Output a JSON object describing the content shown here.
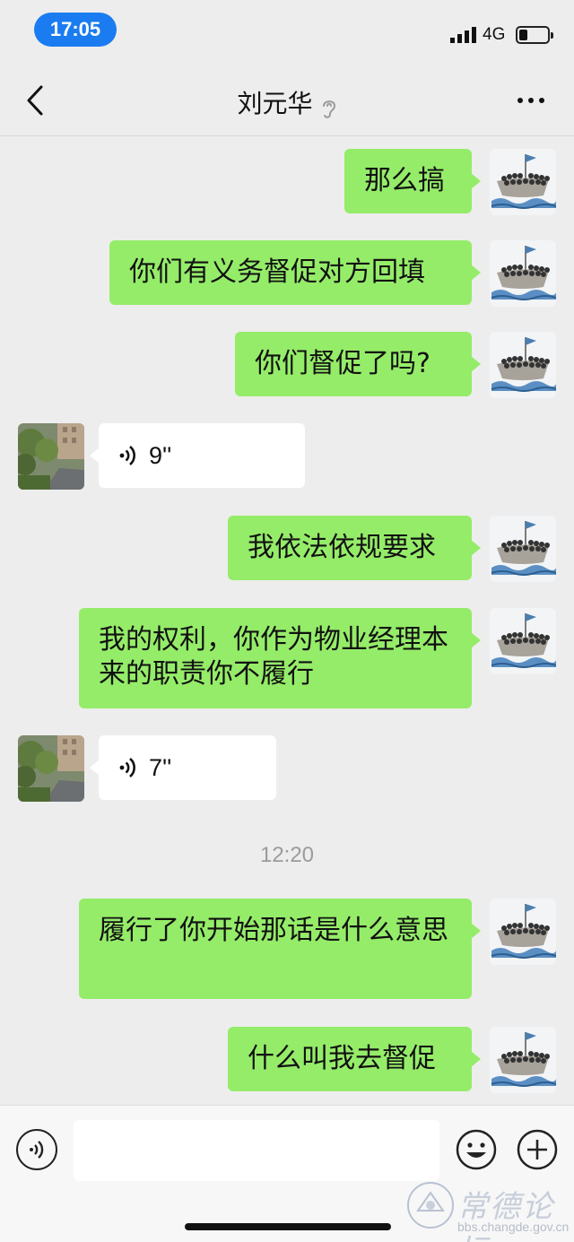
{
  "status_bar": {
    "time": "17:05",
    "network": "4G",
    "accent_color": "#1a7cf0"
  },
  "nav": {
    "title": "刘元华",
    "back_icon": "chevron-left-icon",
    "more_icon": "more-dots-icon",
    "ear_icon": "ear-icon"
  },
  "messages": [
    {
      "side": "out",
      "type": "text",
      "text": "那么搞"
    },
    {
      "side": "out",
      "type": "text",
      "text": "你们有义务督促对方回填"
    },
    {
      "side": "out",
      "type": "text",
      "text": "你们督促了吗?"
    },
    {
      "side": "in",
      "type": "voice",
      "duration": "9''"
    },
    {
      "side": "out",
      "type": "text",
      "text": "我依法依规要求"
    },
    {
      "side": "out",
      "type": "text",
      "text": "我的权利，你作为物业经理本来的职责你不履行"
    },
    {
      "side": "in",
      "type": "voice",
      "duration": "7''"
    },
    {
      "type": "timestamp",
      "text": "12:20"
    },
    {
      "side": "out",
      "type": "text",
      "text": "履行了你开始那话是什么意思"
    },
    {
      "side": "out",
      "type": "text",
      "text": "什么叫我去督促"
    }
  ],
  "input_bar": {
    "placeholder": "",
    "voice_icon": "voice-icon",
    "emoji_icon": "emoji-icon",
    "plus_icon": "plus-icon"
  },
  "watermark": {
    "title": "常德论坛",
    "url": "bbs.changde.gov.cn"
  },
  "colors": {
    "background": "#ededed",
    "outgoing_bubble": "#95ec69",
    "incoming_bubble": "#ffffff"
  }
}
